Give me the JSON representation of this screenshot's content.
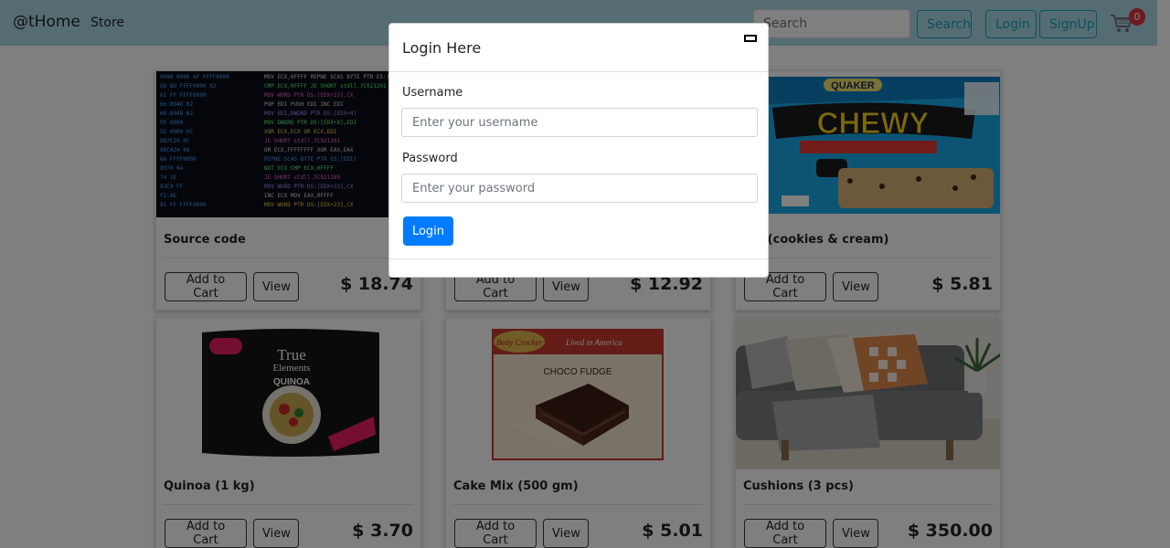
{
  "navbar": {
    "brand": "@tHome",
    "store_link": "Store",
    "search_placeholder": "Search",
    "search_button": "Search",
    "login_button": "Login",
    "signup_button": "SignUp",
    "cart_count": "0"
  },
  "products": [
    {
      "title": "Source code",
      "price": "$ 18.74",
      "add_label": "Add to Cart",
      "view_label": "View"
    },
    {
      "title": "",
      "price": "$ 12.92",
      "add_label": "Add to Cart",
      "view_label": "View"
    },
    {
      "title": "ola (cookies & cream)",
      "price": "$ 5.81",
      "add_label": "Add to Cart",
      "view_label": "View"
    },
    {
      "title": "Quinoa (1 kg)",
      "price": "$ 3.70",
      "add_label": "Add to Cart",
      "view_label": "View"
    },
    {
      "title": "Cake Mix (500 gm)",
      "price": "$ 5.01",
      "add_label": "Add to Cart",
      "view_label": "View"
    },
    {
      "title": "Cushions (3 pcs)",
      "price": "$ 350.00",
      "add_label": "Add to Cart",
      "view_label": "View"
    }
  ],
  "modal": {
    "title": "Login Here",
    "username_label": "Username",
    "username_placeholder": "Enter your username",
    "password_label": "Password",
    "password_placeholder": "Enter your password",
    "submit_label": "Login"
  },
  "colors": {
    "navbar_bg": "#add8e6",
    "outline_accent": "#17a2b8",
    "primary": "#007bff",
    "badge": "#dc3545"
  }
}
